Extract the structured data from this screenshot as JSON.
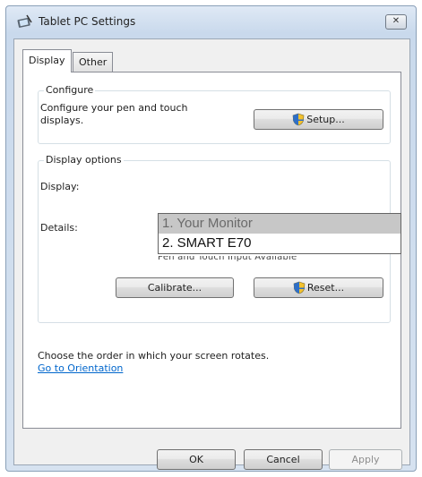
{
  "window": {
    "title": "Tablet PC Settings",
    "close_label": "✕"
  },
  "tabs": [
    {
      "label": "Display",
      "active": true
    },
    {
      "label": "Other",
      "active": false
    }
  ],
  "configure": {
    "legend": "Configure",
    "text_line1": "Configure your pen and touch",
    "text_line2": "displays.",
    "setup_label": "Setup..."
  },
  "display_options": {
    "legend": "Display options",
    "display_label": "Display:",
    "details_label": "Details:",
    "details_value": "Pen and Touch Input Available",
    "dropdown_items": [
      "1. Your Monitor",
      "2. SMART E70"
    ],
    "calibrate_label": "Calibrate...",
    "reset_label": "Reset..."
  },
  "orientation": {
    "text": "Choose the order in which your screen rotates.",
    "link": "Go to Orientation"
  },
  "footer": {
    "ok_label": "OK",
    "cancel_label": "Cancel",
    "apply_label": "Apply"
  },
  "colors": {
    "link": "#0066cc",
    "selected_item_bg": "#c7c7c7"
  },
  "icons": {
    "title": "tablet-pc-icon",
    "shield": "uac-shield-icon",
    "close": "close-icon"
  }
}
